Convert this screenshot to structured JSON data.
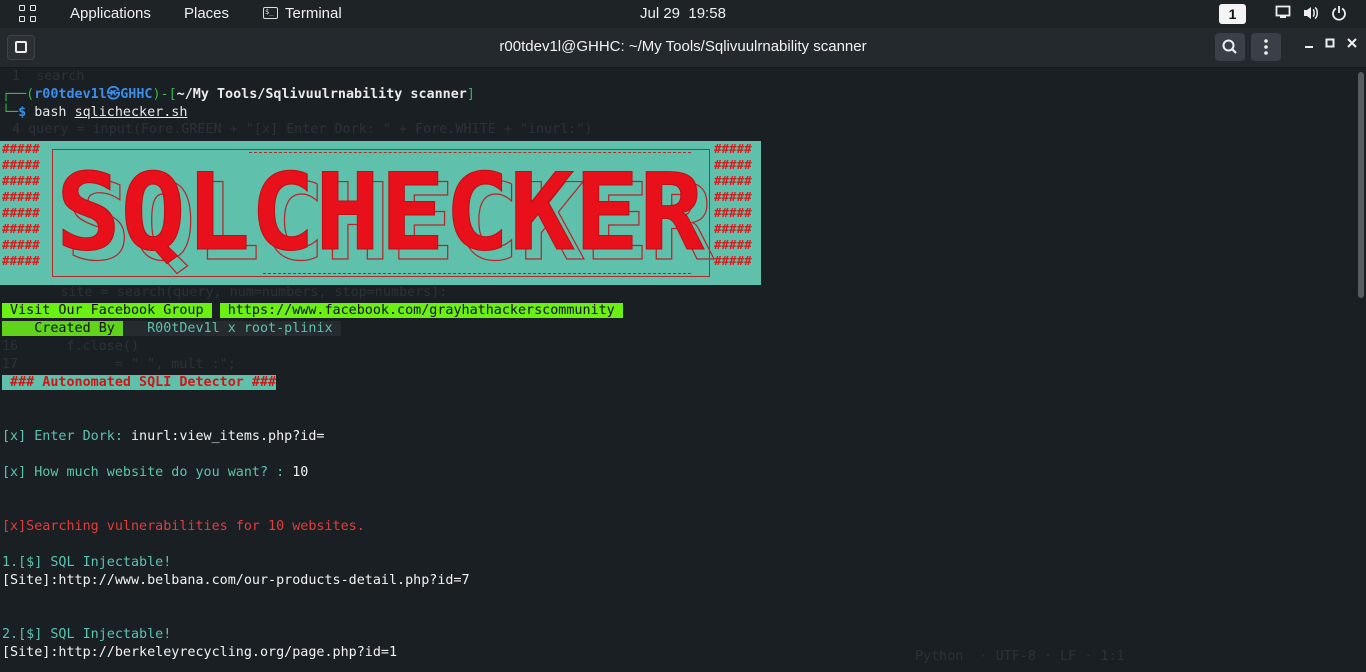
{
  "panel": {
    "applications": "Applications",
    "places": "Places",
    "terminal": "Terminal",
    "date": "Jul 29",
    "time": "19:58",
    "workspace": "1"
  },
  "window": {
    "title": "r00tdev1l@GHHC: ~/My Tools/Sqlivuulrnability scanner"
  },
  "terminal": {
    "prompt_user": "r00tdev1l㉿GHHC",
    "prompt_path": "~/My Tools/Sqlivuulrnability scanner",
    "command_prefix": "bash ",
    "command_file": "sqlichecker.sh",
    "ghost_search": "search",
    "ghost_query": "query = input(Fore.GREEN + \"[x] Enter Dork: \" + Fore.WHITE + \"inurl:\")",
    "ghost_site": "site = search(query, num=numbers, stop=numbers):",
    "ghost_fclose": "f.close()",
    "ghost_split": "= \" \", mult :\";",
    "ghost_status": "Python  · UTF-8 · LF · 1:1",
    "banner_text": "SQLCHECKER",
    "facebook_label": " Visit Our Facebook Group ",
    "facebook_url": " https://www.facebook.com/grayhathackerscommunity ",
    "created_label": "    Created By ",
    "created_by": "   R00tDev1l x root-plinix ",
    "detector_label": " ### Autonomated SQLI Detector ###",
    "dork_label": "[x] Enter Dork: ",
    "dork_value": "inurl:view_items.php?id=",
    "count_label": "[x] How much website do you want? : ",
    "count_value": "10",
    "searching": "[x]Searching vulnerabilities for 10 websites.",
    "results": [
      {
        "heading": "1.[$] SQL Injectable!",
        "site": "[Site]:http://www.belbana.com/our-products-detail.php?id=7"
      },
      {
        "heading": "2.[$] SQL Injectable!",
        "site": "[Site]:http://berkeleyrecycling.org/page.php?id=1"
      }
    ]
  }
}
